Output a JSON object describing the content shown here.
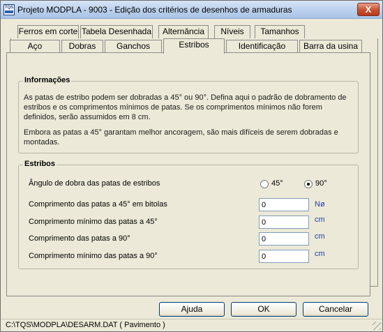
{
  "window": {
    "title": "Projeto MODPLA - 9003 - Edição dos critérios de desenhos de armaduras",
    "close_label": "X",
    "app_icon_text": "TQS"
  },
  "tabs_row1": [
    "Ferros em corte",
    "Tabela Desenhada",
    "Alternância",
    "Níveis",
    "Tamanhos"
  ],
  "tabs_row2": [
    "Aço",
    "Dobras",
    "Ganchos",
    "Estribos",
    "Identificação",
    "Barra da usina"
  ],
  "active_tab": "Estribos",
  "info": {
    "title": "Informações",
    "paragraph1": "As patas de estribo podem ser dobradas a 45° ou 90°. Defina aqui o padrão de dobramento de estribos e os comprimentos mínimos de patas. Se os comprimentos mínimos não forem definidos, serão assumidos em 8 cm.",
    "paragraph2": "Embora as patas a 45° garantam melhor ancoragem, são mais difíceis de serem dobradas e montadas."
  },
  "estribos": {
    "title": "Estribos",
    "angle_label": "Ângulo de dobra das patas de estribos",
    "option_45": "45°",
    "option_90": "90°",
    "selected_angle": "90°",
    "rows": [
      {
        "label": "Comprimento das patas a 45° em bitolas",
        "value": "0",
        "unit": "Nø"
      },
      {
        "label": "Comprimento mínimo das patas a 45°",
        "value": "0",
        "unit": "cm"
      },
      {
        "label": "Comprimento das patas a 90°",
        "value": "0",
        "unit": "cm"
      },
      {
        "label": "Comprimento mínimo das patas a 90°",
        "value": "0",
        "unit": "cm"
      }
    ]
  },
  "buttons": {
    "help": "Ajuda",
    "ok": "OK",
    "cancel": "Cancelar"
  },
  "status": {
    "path": "C:\\TQS\\MODPLA\\DESARM.DAT ( Pavimento )"
  },
  "colors": {
    "accent": "#1f3fa0",
    "panel_bg": "#ece9d8",
    "close": "#c94f2e"
  }
}
